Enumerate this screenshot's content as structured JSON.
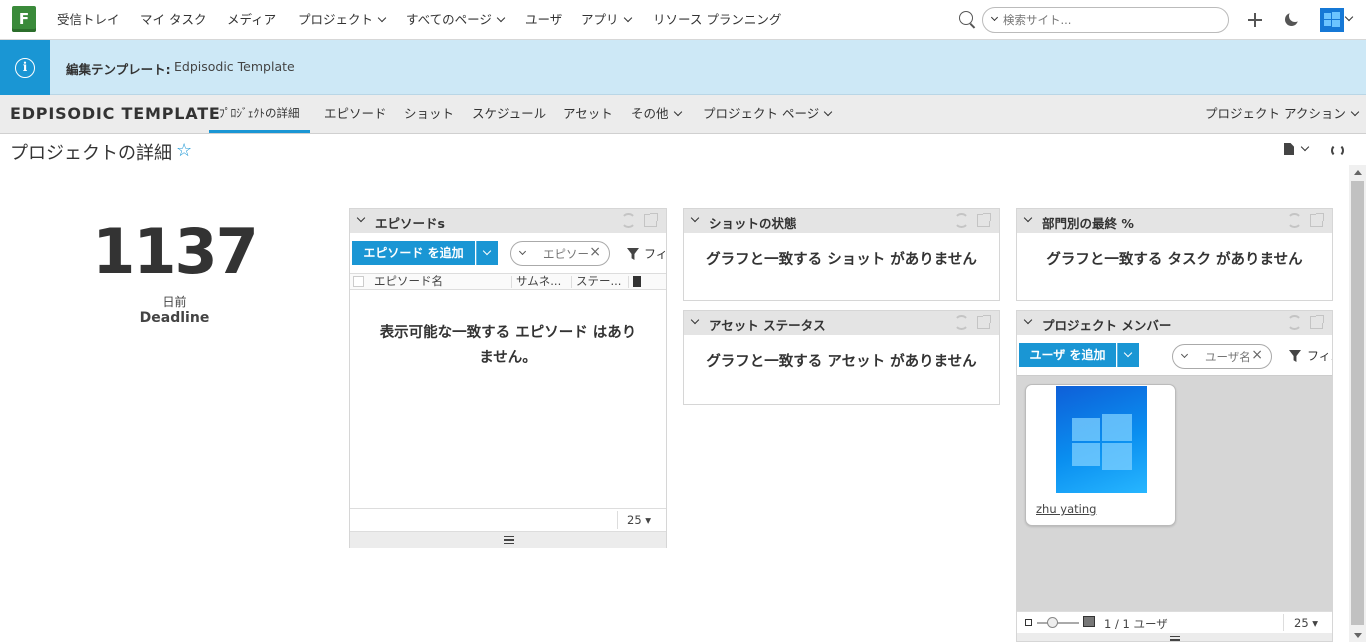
{
  "topnav": {
    "logo": "F",
    "items": [
      {
        "label": "受信トレイ",
        "has_menu": false
      },
      {
        "label": "マイ タスク",
        "has_menu": false
      },
      {
        "label": "メディア",
        "has_menu": false
      },
      {
        "label": "プロジェクト",
        "has_menu": true
      },
      {
        "label": "すべてのページ",
        "has_menu": true
      },
      {
        "label": "ユーザ",
        "has_menu": false
      },
      {
        "label": "アプリ",
        "has_menu": true
      },
      {
        "label": "リソース プランニング",
        "has_menu": false
      }
    ],
    "search_placeholder": "検索サイト..."
  },
  "infobar": {
    "label": "編集テンプレート:",
    "value": "Edpisodic Template"
  },
  "project": {
    "title": "EDPISODIC TEMPLATE",
    "tabs": [
      {
        "label": "ﾌﾟﾛｼﾞｪｸﾄの詳細",
        "active": true,
        "has_menu": false
      },
      {
        "label": "エピソード",
        "active": false,
        "has_menu": false
      },
      {
        "label": "ショット",
        "active": false,
        "has_menu": false
      },
      {
        "label": "スケジュール",
        "active": false,
        "has_menu": false
      },
      {
        "label": "アセット",
        "active": false,
        "has_menu": false
      },
      {
        "label": "その他",
        "active": false,
        "has_menu": true
      },
      {
        "label": "プロジェクト ページ",
        "active": false,
        "has_menu": true
      }
    ],
    "actions_label": "プロジェクト アクション"
  },
  "page": {
    "title": "プロジェクトの詳細",
    "star": "☆"
  },
  "countdown": {
    "value": "1137",
    "unit": "日前",
    "label": "Deadline"
  },
  "episodes_widget": {
    "title": "エピソードs",
    "add_button": "エピソード を追加",
    "filter_placeholder": "エピソード",
    "filter_label": "フィルタ",
    "columns": [
      "エピソード名",
      "サムネ...",
      "ステー..."
    ],
    "empty_message_line1": "表示可能な一致する エピソード はあり",
    "empty_message_line2": "ません。",
    "page_size": "25 ▾"
  },
  "shot_status_widget": {
    "title": "ショットの状態",
    "empty_message": "グラフと一致する ショット がありません"
  },
  "asset_status_widget": {
    "title": "アセット ステータス",
    "empty_message": "グラフと一致する アセット がありません"
  },
  "dept_widget": {
    "title": "部門別の最終 %",
    "empty_message": "グラフと一致する タスク がありません"
  },
  "members_widget": {
    "title": "プロジェクト メンバー",
    "add_button": "ユーザ を追加",
    "filter_placeholder": "ユーザ名",
    "filter_label": "フィルタ",
    "members": [
      {
        "name": "zhu yating"
      }
    ],
    "count_text": "1 / 1 ユーザ",
    "page_size": "25 ▾"
  },
  "colors": {
    "accent": "#1a96d4",
    "infobar_bg": "#cde8f6",
    "widget_header": "#e4e4e4"
  }
}
